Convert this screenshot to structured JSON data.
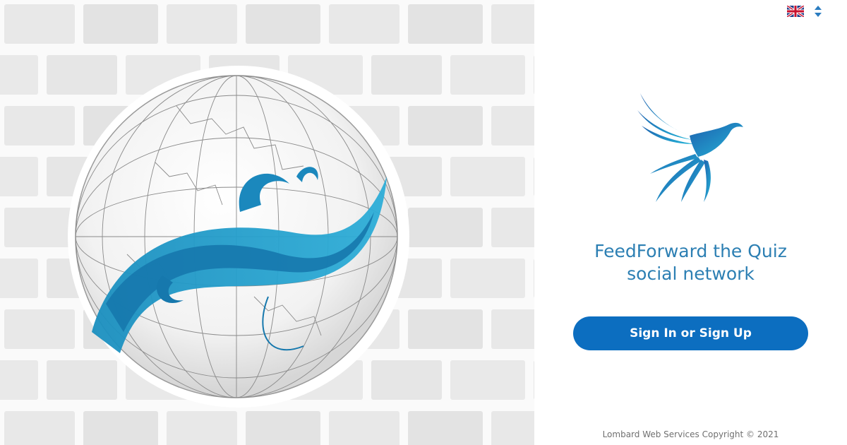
{
  "hero": {
    "image_name": "globe-illustration"
  },
  "panel": {
    "language": {
      "current": "English",
      "flag": "uk-flag-icon"
    },
    "logo": "bird-logo",
    "headline_line1": "FeedForward the Quiz",
    "headline_line2": "social network",
    "signin_label": "Sign In or Sign Up",
    "footer_text": "Lombard Web Services Copyright © 2021"
  },
  "colors": {
    "accent": "#0c6ec0",
    "headline": "#2c7fb3",
    "logo_blue": "#1f9fcf",
    "footer": "#707070"
  }
}
